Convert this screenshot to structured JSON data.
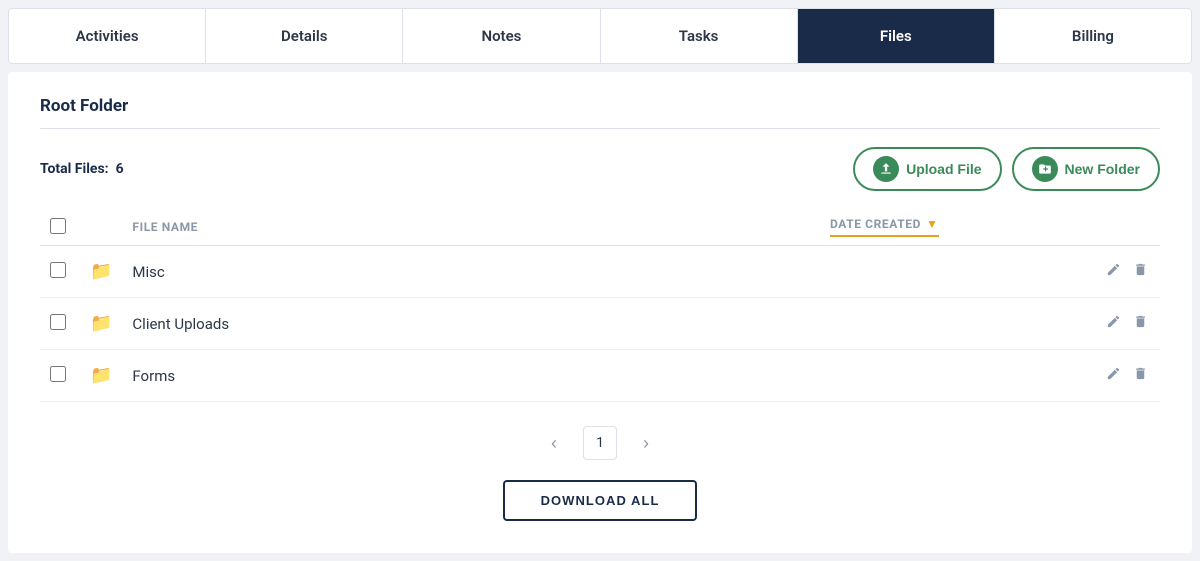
{
  "tabs": [
    {
      "id": "activities",
      "label": "Activities",
      "active": false
    },
    {
      "id": "details",
      "label": "Details",
      "active": false
    },
    {
      "id": "notes",
      "label": "Notes",
      "active": false
    },
    {
      "id": "tasks",
      "label": "Tasks",
      "active": false
    },
    {
      "id": "files",
      "label": "Files",
      "active": true
    },
    {
      "id": "billing",
      "label": "Billing",
      "active": false
    }
  ],
  "section": {
    "title": "Root Folder",
    "total_files_label": "Total Files:",
    "total_files_count": "6"
  },
  "toolbar": {
    "upload_label": "Upload File",
    "new_folder_label": "New Folder"
  },
  "table": {
    "col_file_name": "FILE NAME",
    "col_date_created": "DATE CREATED",
    "rows": [
      {
        "id": 1,
        "name": "Misc",
        "date": ""
      },
      {
        "id": 2,
        "name": "Client Uploads",
        "date": ""
      },
      {
        "id": 3,
        "name": "Forms",
        "date": ""
      }
    ]
  },
  "pagination": {
    "current_page": "1",
    "prev_label": "‹",
    "next_label": "›"
  },
  "download_all_label": "DOWNLOAD ALL"
}
